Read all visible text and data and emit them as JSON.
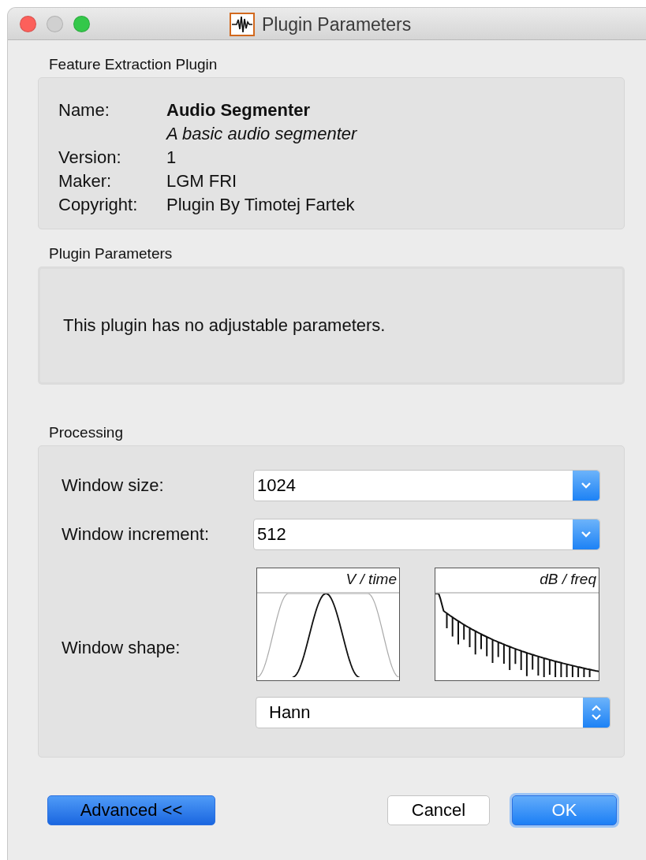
{
  "window": {
    "title": "Plugin Parameters"
  },
  "plugin_info": {
    "heading": "Feature Extraction Plugin",
    "rows": [
      {
        "label": "Name:",
        "value": "Audio Segmenter",
        "kind": "name"
      },
      {
        "label": "",
        "value": "A basic audio segmenter",
        "kind": "description"
      },
      {
        "label": "Version:",
        "value": "1",
        "kind": "plain"
      },
      {
        "label": "Maker:",
        "value": "LGM FRI",
        "kind": "plain"
      },
      {
        "label": "Copyright:",
        "value": "Plugin By Timotej Fartek",
        "kind": "plain"
      }
    ]
  },
  "plugin_parameters": {
    "heading": "Plugin Parameters",
    "message": "This plugin has no adjustable parameters."
  },
  "processing": {
    "heading": "Processing",
    "fields": [
      {
        "label": "Window size:",
        "value": "1024"
      },
      {
        "label": "Window increment:",
        "value": "512"
      }
    ],
    "window_shape": {
      "label": "Window shape:",
      "plots": [
        {
          "caption": "V / time",
          "kind": "time"
        },
        {
          "caption": "dB / freq",
          "kind": "freq"
        }
      ],
      "value": "Hann"
    }
  },
  "buttons": [
    {
      "label": "Advanced <<",
      "kind": "primary"
    },
    {
      "label": "Cancel",
      "kind": "plain"
    },
    {
      "label": "OK",
      "kind": "default"
    }
  ]
}
